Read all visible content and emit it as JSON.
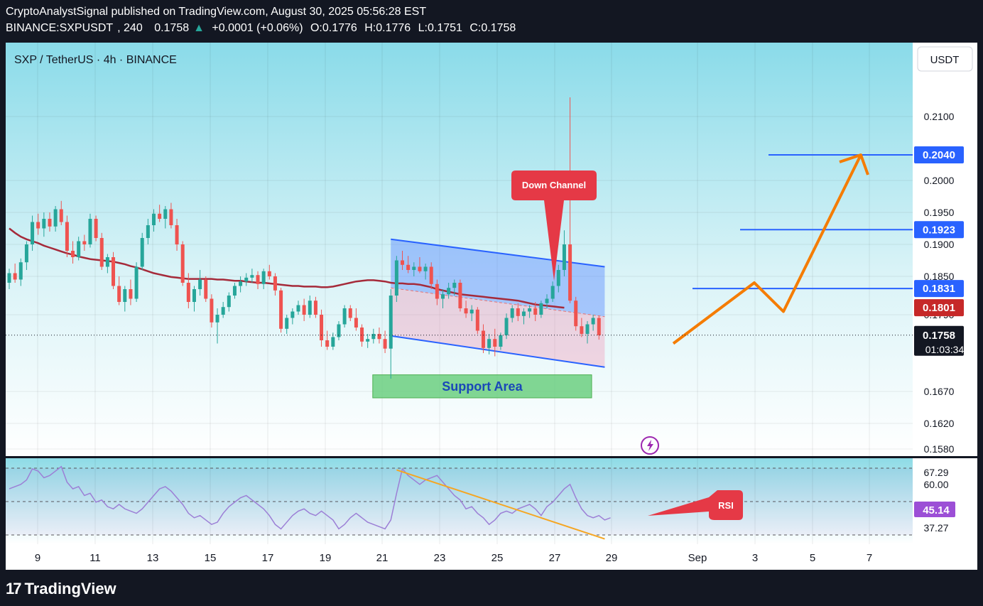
{
  "header": {
    "published_line": "CryptoAnalystSignal published on TradingView.com, August 30, 2025 05:56:28 EST",
    "symbol": "BINANCE:SXPUSDT",
    "interval": "240",
    "last": "0.1758",
    "change": "+0.0001 (+0.06%)",
    "open": "O:0.1776",
    "high": "H:0.1776",
    "low": "L:0.1751",
    "close": "C:0.1758"
  },
  "pane_title": "SXP / TetherUS · 4h · BINANCE",
  "currency_button": "USDT",
  "footer": {
    "brand": "TradingView",
    "logo_mark": "17"
  },
  "colors": {
    "background_top": "#9fe2ee",
    "background_bottom": "#ffffff",
    "up_candle": "#26a69a",
    "down_candle": "#ef5350",
    "ema": "#a52a3a",
    "channel_line": "#2962ff",
    "forecast_arrow": "#f57c00",
    "rsi_line": "#9c7fd6",
    "rsi_trend": "#f5a623",
    "support_fill": "#6ccf80",
    "label_red": "#e53946",
    "hline_blue": "#2962ff"
  },
  "chart_data": [
    {
      "type": "candlestick",
      "title": "SXP / TetherUS · 4h · BINANCE",
      "x_ticks": [
        "9",
        "11",
        "13",
        "15",
        "17",
        "19",
        "21",
        "23",
        "25",
        "27",
        "29",
        "Sep",
        "3",
        "5",
        "7"
      ],
      "y_ticks": [
        "0.2100",
        "0.2000",
        "0.1950",
        "0.1900",
        "0.1850",
        "0.1790",
        "0.1670",
        "0.1620",
        "0.1580"
      ],
      "ylim": [
        0.1572,
        0.2135
      ],
      "price_labels": [
        {
          "value": "0.2040",
          "kind": "level"
        },
        {
          "value": "0.1923",
          "kind": "level"
        },
        {
          "value": "0.1831",
          "kind": "level"
        },
        {
          "value": "0.1801",
          "kind": "ema"
        },
        {
          "value": "0.1758",
          "kind": "last"
        }
      ],
      "countdown": "01:03:34",
      "horizontal_levels": [
        0.204,
        0.1923,
        0.1831
      ],
      "last_price": 0.1758,
      "candles_ohlc_approx": [
        [
          0.184,
          0.1862,
          0.183,
          0.1855
        ],
        [
          0.1855,
          0.187,
          0.184,
          0.1845
        ],
        [
          0.1845,
          0.1878,
          0.1835,
          0.1872
        ],
        [
          0.1872,
          0.1905,
          0.186,
          0.19
        ],
        [
          0.19,
          0.1945,
          0.189,
          0.1935
        ],
        [
          0.1935,
          0.1948,
          0.1915,
          0.1925
        ],
        [
          0.1925,
          0.195,
          0.1912,
          0.194
        ],
        [
          0.194,
          0.195,
          0.192,
          0.1928
        ],
        [
          0.1928,
          0.196,
          0.192,
          0.1955
        ],
        [
          0.1955,
          0.1968,
          0.193,
          0.1935
        ],
        [
          0.1935,
          0.1945,
          0.188,
          0.189
        ],
        [
          0.189,
          0.1905,
          0.187,
          0.188
        ],
        [
          0.188,
          0.1912,
          0.1875,
          0.1905
        ],
        [
          0.1905,
          0.1915,
          0.189,
          0.19
        ],
        [
          0.19,
          0.1948,
          0.1895,
          0.194
        ],
        [
          0.194,
          0.1945,
          0.1905,
          0.191
        ],
        [
          0.191,
          0.1918,
          0.186,
          0.1865
        ],
        [
          0.1865,
          0.1885,
          0.1855,
          0.188
        ],
        [
          0.188,
          0.1888,
          0.183,
          0.1835
        ],
        [
          0.1835,
          0.185,
          0.1805,
          0.181
        ],
        [
          0.181,
          0.1835,
          0.1795,
          0.183
        ],
        [
          0.183,
          0.1845,
          0.1805,
          0.1815
        ],
        [
          0.1815,
          0.1872,
          0.181,
          0.1865
        ],
        [
          0.1865,
          0.1918,
          0.186,
          0.191
        ],
        [
          0.191,
          0.194,
          0.19,
          0.193
        ],
        [
          0.193,
          0.1955,
          0.192,
          0.1948
        ],
        [
          0.1948,
          0.1962,
          0.1935,
          0.194
        ],
        [
          0.194,
          0.196,
          0.1925,
          0.1955
        ],
        [
          0.1955,
          0.1965,
          0.1925,
          0.193
        ],
        [
          0.193,
          0.194,
          0.189,
          0.19
        ],
        [
          0.19,
          0.1905,
          0.1835,
          0.184
        ],
        [
          0.184,
          0.1855,
          0.18,
          0.181
        ],
        [
          0.181,
          0.1835,
          0.1795,
          0.183
        ],
        [
          0.183,
          0.186,
          0.182,
          0.1845
        ],
        [
          0.1845,
          0.185,
          0.181,
          0.1815
        ],
        [
          0.1815,
          0.1822,
          0.177,
          0.1778
        ],
        [
          0.1778,
          0.18,
          0.1745,
          0.179
        ],
        [
          0.179,
          0.181,
          0.1785,
          0.1802
        ],
        [
          0.1802,
          0.1825,
          0.1795,
          0.182
        ],
        [
          0.182,
          0.184,
          0.1815,
          0.1835
        ],
        [
          0.1835,
          0.185,
          0.1825,
          0.1842
        ],
        [
          0.1842,
          0.1855,
          0.1835,
          0.1848
        ],
        [
          0.1848,
          0.1862,
          0.184,
          0.1852
        ],
        [
          0.1852,
          0.1858,
          0.183,
          0.1838
        ],
        [
          0.1838,
          0.1862,
          0.183,
          0.1858
        ],
        [
          0.1858,
          0.1868,
          0.1845,
          0.185
        ],
        [
          0.185,
          0.1855,
          0.182,
          0.1828
        ],
        [
          0.1828,
          0.1832,
          0.1762,
          0.1768
        ],
        [
          0.1768,
          0.179,
          0.176,
          0.1785
        ],
        [
          0.1785,
          0.18,
          0.1775,
          0.1795
        ],
        [
          0.1795,
          0.1812,
          0.179,
          0.1805
        ],
        [
          0.1805,
          0.1815,
          0.178,
          0.179
        ],
        [
          0.179,
          0.182,
          0.1785,
          0.1812
        ],
        [
          0.1812,
          0.1818,
          0.1785,
          0.179
        ],
        [
          0.179,
          0.1798,
          0.174,
          0.175
        ],
        [
          0.175,
          0.1765,
          0.1735,
          0.174
        ],
        [
          0.174,
          0.1762,
          0.1735,
          0.1755
        ],
        [
          0.1755,
          0.178,
          0.175,
          0.1775
        ],
        [
          0.1775,
          0.1805,
          0.177,
          0.18
        ],
        [
          0.18,
          0.1805,
          0.178,
          0.1785
        ],
        [
          0.1785,
          0.18,
          0.1765,
          0.177
        ],
        [
          0.177,
          0.1775,
          0.174,
          0.1748
        ],
        [
          0.1748,
          0.176,
          0.1738,
          0.1752
        ],
        [
          0.1752,
          0.1768,
          0.1745,
          0.176
        ],
        [
          0.176,
          0.177,
          0.1745,
          0.1752
        ],
        [
          0.1752,
          0.1765,
          0.173,
          0.1737
        ],
        [
          0.1737,
          0.183,
          0.169,
          0.182
        ],
        [
          0.182,
          0.1882,
          0.181,
          0.1875
        ],
        [
          0.1875,
          0.189,
          0.186,
          0.1868
        ],
        [
          0.1868,
          0.1882,
          0.1855,
          0.186
        ],
        [
          0.186,
          0.1872,
          0.185,
          0.1865
        ],
        [
          0.1865,
          0.188,
          0.1855,
          0.1858
        ],
        [
          0.1858,
          0.187,
          0.1845,
          0.1865
        ],
        [
          0.1865,
          0.1872,
          0.183,
          0.1838
        ],
        [
          0.1838,
          0.1845,
          0.1805,
          0.1815
        ],
        [
          0.1815,
          0.183,
          0.18,
          0.1822
        ],
        [
          0.1822,
          0.184,
          0.1815,
          0.1832
        ],
        [
          0.1832,
          0.1845,
          0.182,
          0.184
        ],
        [
          0.184,
          0.1845,
          0.1795,
          0.18
        ],
        [
          0.18,
          0.1812,
          0.1785,
          0.1792
        ],
        [
          0.1792,
          0.1805,
          0.178,
          0.1798
        ],
        [
          0.1798,
          0.1802,
          0.176,
          0.1765
        ],
        [
          0.1765,
          0.1775,
          0.173,
          0.1738
        ],
        [
          0.1738,
          0.176,
          0.1728,
          0.1752
        ],
        [
          0.1752,
          0.1768,
          0.1725,
          0.174
        ],
        [
          0.174,
          0.1762,
          0.1735,
          0.1758
        ],
        [
          0.1758,
          0.1792,
          0.1752,
          0.1785
        ],
        [
          0.1785,
          0.1805,
          0.1778,
          0.18
        ],
        [
          0.18,
          0.1808,
          0.178,
          0.1788
        ],
        [
          0.1788,
          0.18,
          0.1775,
          0.1795
        ],
        [
          0.1795,
          0.1805,
          0.1785,
          0.18
        ],
        [
          0.18,
          0.181,
          0.178,
          0.179
        ],
        [
          0.179,
          0.1812,
          0.1785,
          0.1808
        ],
        [
          0.1808,
          0.1822,
          0.18,
          0.1815
        ],
        [
          0.1815,
          0.1842,
          0.181,
          0.1835
        ],
        [
          0.1835,
          0.1868,
          0.1825,
          0.186
        ],
        [
          0.186,
          0.1922,
          0.185,
          0.19
        ],
        [
          0.19,
          0.213,
          0.1808,
          0.1812
        ],
        [
          0.1812,
          0.1818,
          0.1765,
          0.1772
        ],
        [
          0.1772,
          0.1785,
          0.1755,
          0.176
        ],
        [
          0.176,
          0.178,
          0.1745,
          0.1775
        ],
        [
          0.1775,
          0.179,
          0.1765,
          0.1785
        ],
        [
          0.1785,
          0.1788,
          0.1751,
          0.1758
        ]
      ],
      "ema_series_approx": [
        0.1925,
        0.1918,
        0.1912,
        0.1908,
        0.1905,
        0.1902,
        0.1898,
        0.1895,
        0.1892,
        0.1889,
        0.1886,
        0.1884,
        0.1881,
        0.1879,
        0.1877,
        0.1876,
        0.1875,
        0.1874,
        0.1873,
        0.1871,
        0.1869,
        0.1866,
        0.1864,
        0.1861,
        0.1858,
        0.1855,
        0.1853,
        0.1851,
        0.1849,
        0.1848,
        0.1847,
        0.1846,
        0.1846,
        0.1846,
        0.1846,
        0.1846,
        0.1845,
        0.1845,
        0.1844,
        0.1843,
        0.1843,
        0.1842,
        0.1841,
        0.184,
        0.184,
        0.1839,
        0.1838,
        0.1837,
        0.1836,
        0.1835,
        0.1835,
        0.1834,
        0.1834,
        0.1834,
        0.1833,
        0.1833,
        0.1834,
        0.1836,
        0.1838,
        0.184,
        0.1842,
        0.1843,
        0.1844,
        0.1844,
        0.1843,
        0.1842,
        0.184,
        0.1839,
        0.1839,
        0.1838,
        0.1838,
        0.1837,
        0.1835,
        0.1833,
        0.183,
        0.1828,
        0.1826,
        0.1824,
        0.1822,
        0.1821,
        0.182,
        0.1819,
        0.1818,
        0.1817,
        0.1816,
        0.1815,
        0.1814,
        0.1813,
        0.1812,
        0.181,
        0.1808,
        0.1806,
        0.1805,
        0.1804,
        0.1803,
        0.1802,
        0.1801
      ],
      "annotations": [
        {
          "text": "Down Channel"
        },
        {
          "text": "Support Area"
        }
      ],
      "channel": {
        "upper": [
          [
            66,
            0.1908
          ],
          [
            103,
            0.1865
          ]
        ],
        "lower": [
          [
            66,
            0.1757
          ],
          [
            103,
            0.1708
          ]
        ],
        "mid_dashed": [
          [
            66,
            0.1832
          ],
          [
            103,
            0.1787
          ]
        ]
      },
      "support_zone": {
        "from_index": 63,
        "to_index": 100,
        "top": 0.1696,
        "bottom": 0.166
      },
      "forecast_path_approx": [
        [
          0.175,
          "start"
        ],
        [
          0.184,
          "peak"
        ],
        [
          0.1795,
          "pullback"
        ],
        [
          0.204,
          "target"
        ]
      ]
    },
    {
      "type": "line",
      "title": "RSI",
      "y_ticks": [
        "67.29",
        "60.00",
        "37.27"
      ],
      "ylim": [
        28,
        74
      ],
      "level_lines": [
        70,
        50,
        30
      ],
      "current_value_label": "45.14",
      "series_approx": [
        58,
        59,
        60,
        62,
        67,
        66,
        63,
        64,
        66,
        68,
        61,
        58,
        59,
        55,
        56,
        52,
        53,
        50,
        49,
        51,
        49,
        48,
        47,
        49,
        52,
        55,
        58,
        59,
        57,
        54,
        51,
        47,
        45,
        46,
        44,
        42,
        43,
        47,
        50,
        52,
        54,
        55,
        53,
        51,
        49,
        46,
        42,
        40,
        43,
        46,
        48,
        49,
        47,
        46,
        48,
        46,
        44,
        40,
        42,
        45,
        47,
        45,
        43,
        42,
        41,
        40,
        44,
        56,
        67,
        64,
        62,
        60,
        62,
        63,
        64,
        61,
        58,
        55,
        53,
        49,
        50,
        47,
        45,
        42,
        44,
        47,
        48,
        47,
        49,
        50,
        51,
        49,
        46,
        50,
        52,
        55,
        58,
        60,
        54,
        49,
        46,
        45,
        46,
        44,
        45
      ],
      "trendline": [
        [
          67,
          66.5
        ],
        [
          103,
          35.5
        ]
      ],
      "annotations": [
        {
          "text": "RSI"
        }
      ]
    }
  ]
}
